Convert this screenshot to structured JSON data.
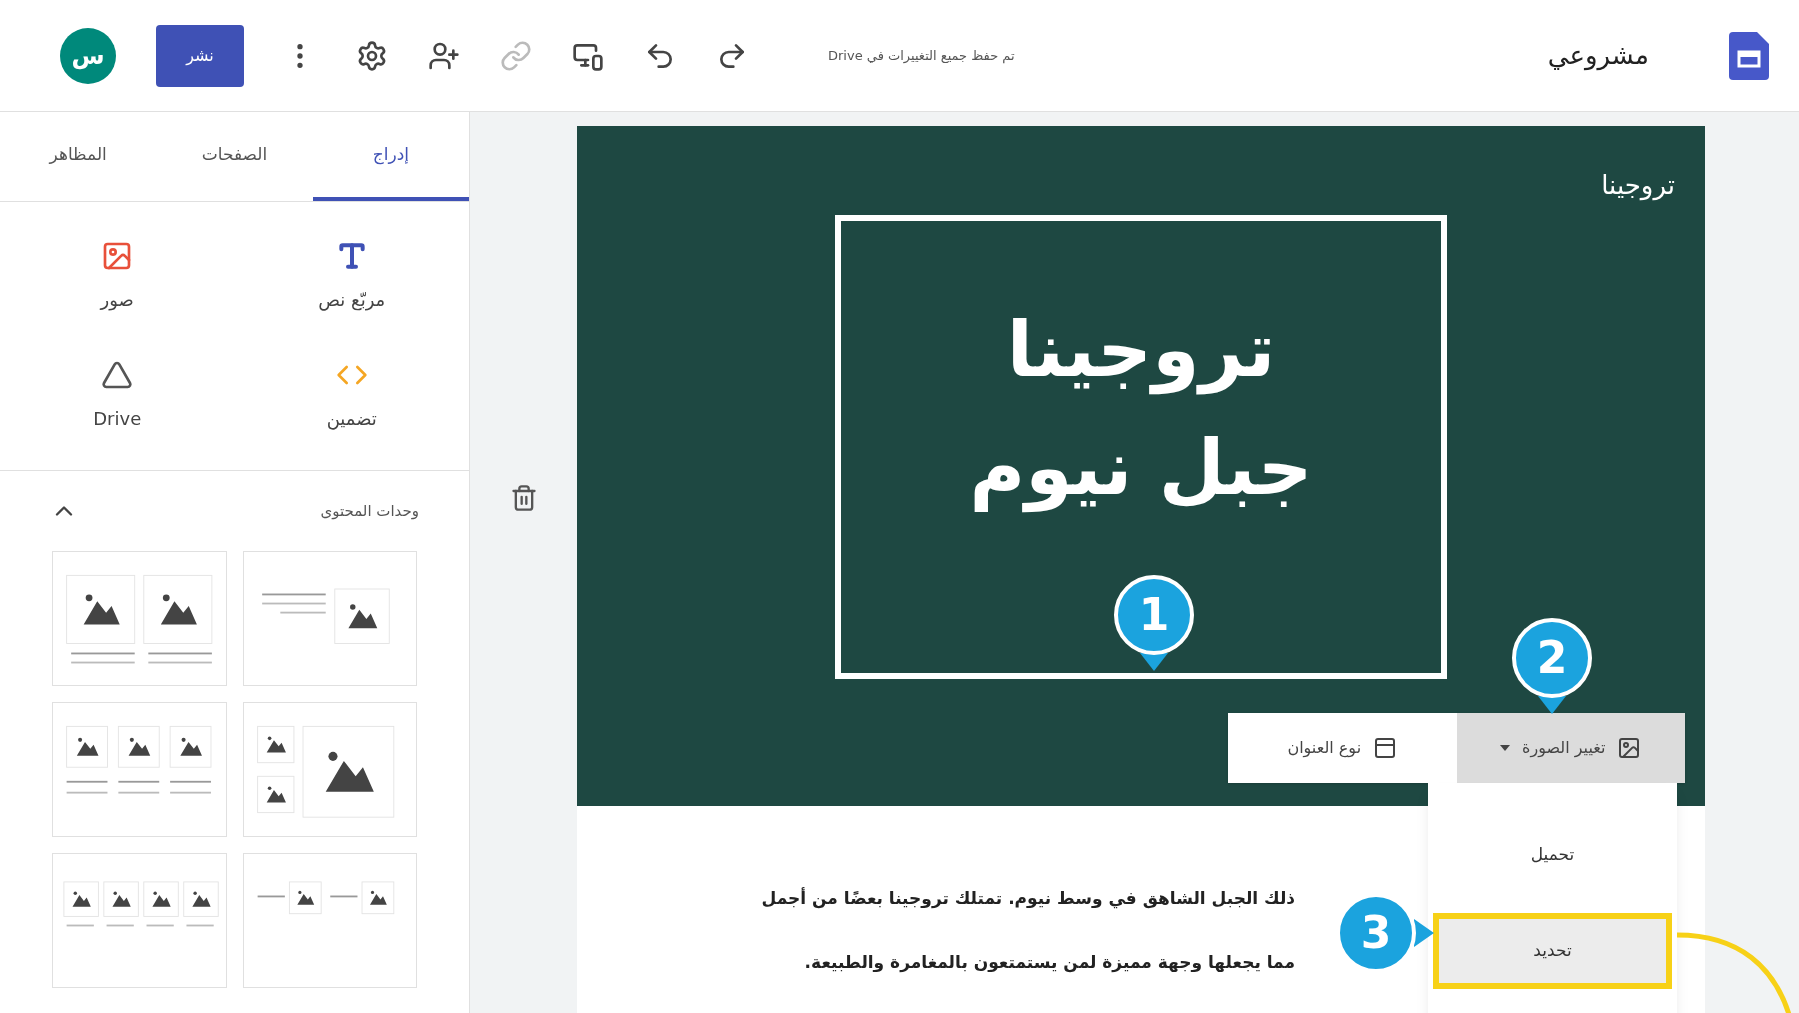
{
  "header": {
    "title": "مشروعي",
    "save_status": "تم حفظ جميع التغييرات في Drive",
    "publish": "نشر",
    "avatar": "س",
    "tools": [
      {
        "kind": "more",
        "disabled": false
      },
      {
        "kind": "settings",
        "disabled": false
      },
      {
        "kind": "share",
        "disabled": false
      },
      {
        "kind": "link",
        "disabled": true
      },
      {
        "kind": "preview",
        "disabled": false
      },
      {
        "kind": "undo",
        "disabled": false
      },
      {
        "kind": "redo",
        "disabled": false
      }
    ]
  },
  "sidebar": {
    "tabs": [
      {
        "label": "إدراج",
        "selected": true
      },
      {
        "label": "الصفحات",
        "selected": false
      },
      {
        "label": "المظاهر",
        "selected": false
      }
    ],
    "insert_items": [
      {
        "label": "مربّع نص",
        "kind": "text"
      },
      {
        "label": "صور",
        "kind": "images"
      },
      {
        "label": "تضمين",
        "kind": "embed"
      },
      {
        "label": "Drive",
        "kind": "drive"
      }
    ],
    "content_blocks": {
      "title": "وحدات المحتوى",
      "expanded": true
    }
  },
  "canvas": {
    "site_name": "تروجينا",
    "title_lines": [
      "تروجينا",
      "جبل نيوم"
    ],
    "image_toolbar": [
      {
        "label": "تغيير الصورة",
        "kind": "change_image",
        "pressed": true
      },
      {
        "label": "نوع العنوان",
        "kind": "header_type",
        "pressed": false
      }
    ],
    "image_menu": [
      {
        "label": "تحميل",
        "selected": false
      },
      {
        "label": "تحديد",
        "selected": true
      }
    ],
    "paragraph_lines": [
      "ذلك الجبل الشاهق في وسط نيوم. تمتلك تروجينا بعضًا من أجمل",
      "مما يجعلها وجهة مميزة لمن يستمتعون بالمغامرة والطبيعة."
    ]
  },
  "callouts": [
    {
      "number": "1"
    },
    {
      "number": "2"
    },
    {
      "number": "3"
    }
  ]
}
